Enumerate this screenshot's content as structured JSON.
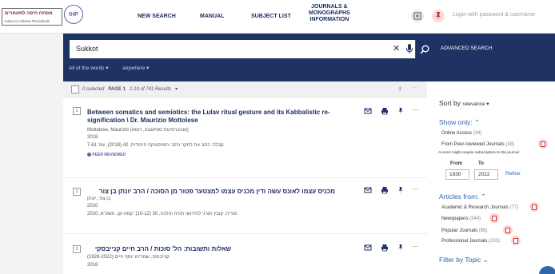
{
  "header": {
    "logo_hebrew": "מפתח חיפה למאמרים",
    "logo_english": "Index to Hebrew Periodicals",
    "logo_badge": "IHP",
    "nav": [
      "NEW SEARCH",
      "MANUAL",
      "SUBJECT LIST",
      "JOURNALS &",
      "MONOGRAPHS",
      "INFORMATION"
    ],
    "login": "Login with password & username",
    "colors": {
      "navy": "#1e3264",
      "accent": "#2f66a8",
      "pin": "#d22b2b"
    }
  },
  "search": {
    "query": "Sukkot",
    "advanced": "ADVANCED SEARCH",
    "filter_words": "All of the words ▾",
    "filter_scope": "anywhere ▾"
  },
  "results_head": {
    "selected": "0 selected",
    "page": "PAGE 1",
    "range": "1-10 of 741 Results",
    "arrow": "▾"
  },
  "results": [
    {
      "num": "1",
      "title_line1": "Between somatics and semiotics: the Lulav ritual gesture and its Kabbalistic re-",
      "title_line2": "signification \\ Dr. Maurizio Mottolese",
      "author": "Mottolese, Maurizio (אוניברסיטת ספיאנצה, רומא)",
      "year": "2018",
      "source": "קבלה: כתב עת לחקר כתבי המיסטיקה היהודית, 42 (2018), עמ' 7-61",
      "peer": "PEER REVIEWED"
    },
    {
      "num": "2",
      "title": "מכניס עצמו לאונס עשה ודין מכניס עצמו למצטער פטור מן הסוכה / הרב יונתן בן צור",
      "author": "בן צור, יונתן",
      "year": "2010",
      "source": "סוריה: קובץ תורני לחידושי תורה והלכה, 30 (10-12): קמה-קנ, תשע\"א, 2010"
    },
    {
      "num": "3",
      "title": "שאלות ותשובות: הל' סוכות / הרב חיים קנייבסקי",
      "author": "קנייבסקי, שמריהו יוסף חיים (1928-2022)",
      "year": "2016"
    }
  ],
  "sidebar": {
    "sort_by": "Sort by",
    "sort_value": "relevance ▾",
    "show_only": "Show only: ⌃",
    "online_access": "Online Access",
    "online_count": "(34)",
    "peer_reviewed": "From Peer-reviewed Journals",
    "peer_count": "(38)",
    "access_note": "Access might require subscription to the journal",
    "from_label": "From",
    "to_label": "To",
    "from_value": "1930",
    "to_value": "2022",
    "refine": "Refine",
    "articles_from": "Articles from: ⌃",
    "sources": [
      {
        "label": "Academic & Research Journals",
        "count": "(77)"
      },
      {
        "label": "Newspapers",
        "count": "(344)"
      },
      {
        "label": "Popular Journals",
        "count": "(88)"
      },
      {
        "label": "Professional Journals",
        "count": "(233)"
      }
    ],
    "filter_topic": "Filter by Topic ⌄"
  }
}
